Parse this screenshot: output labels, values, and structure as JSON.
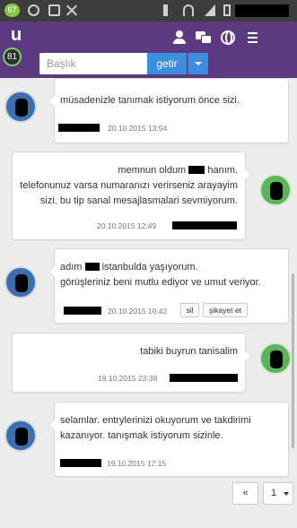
{
  "status_bar": {
    "badge": "67"
  },
  "header": {
    "logo": "u",
    "score": "81",
    "search": {
      "placeholder": "Başlık",
      "button_label": "getir"
    }
  },
  "messages": [
    {
      "side": "left",
      "text": "müsadenizle tanımak istiyorum önce sizi.",
      "date": "20.10.2015 13:54"
    },
    {
      "side": "right",
      "text_a": "memnun oldum",
      "text_b": "hanım.",
      "text_c": "telefonunuz varsa numaranızı verirseniz arayayim sizi. bu tip sanal mesajlasmalari sevmiyorum.",
      "date": "20.10.2015 12:49"
    },
    {
      "side": "left",
      "text_a": "adım",
      "text_b": "istanbulda yaşıyorum.",
      "text_c": "görüşleriniz beni mutlu ediyor ve umut veriyor.",
      "date": "20.10.2015 10:42",
      "actions": [
        "sil",
        "şikayet et"
      ]
    },
    {
      "side": "right",
      "text": "tabiki buyrun tanisalim",
      "date": "19.10.2015 23:38"
    },
    {
      "side": "left",
      "text": "selamlar. entrylerinizi okuyorum ve takdirimi kazanıyor. tanışmak istiyorum sizinle.",
      "date": "19.10.2015 17:15"
    }
  ],
  "pagination": {
    "prev_label": "«",
    "current_page": "1"
  }
}
